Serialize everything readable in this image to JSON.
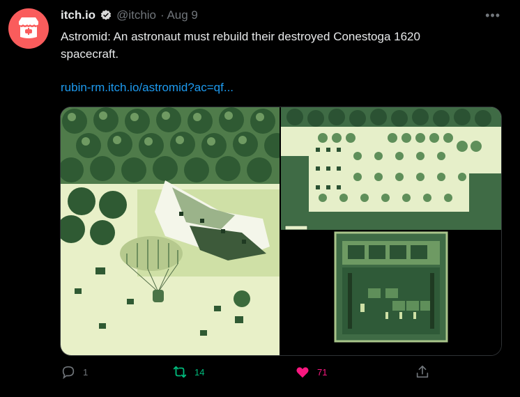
{
  "tweet": {
    "display_name": "itch.io",
    "handle": "@itchio",
    "date": "· Aug 9",
    "text": "Astromid: An astronaut must rebuild their destroyed Conestoga 1620 spacecraft.",
    "link": "rubin-rm.itch.io/astromid?ac=qf..."
  },
  "actions": {
    "reply_count": "1",
    "retweet_count": "14",
    "like_count": "71"
  },
  "colors": {
    "avatar_bg": "#fa5c5c",
    "link": "#1d9bf0",
    "retweet": "#00ba7c",
    "like": "#f91880",
    "muted": "#71767b"
  },
  "icons": [
    "itchio-logo-icon",
    "verified-badge-icon",
    "more-icon",
    "reply-icon",
    "retweet-icon",
    "like-icon",
    "share-icon"
  ]
}
